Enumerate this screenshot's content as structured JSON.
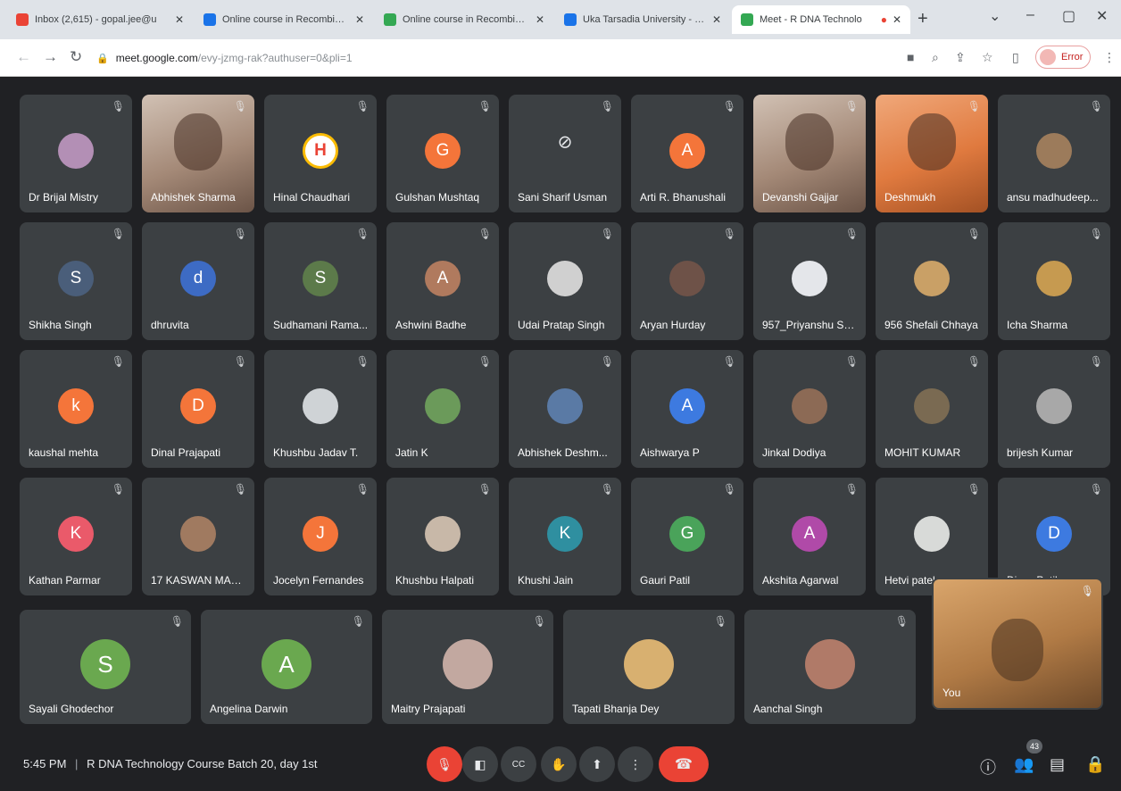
{
  "browser": {
    "tabs": [
      {
        "title": "Inbox (2,615) - gopal.jee@u",
        "color": "#ea4335",
        "active": false
      },
      {
        "title": "Online course in Recombinan",
        "color": "#1a73e8",
        "active": false
      },
      {
        "title": "Online course in Recombinan",
        "color": "#34a853",
        "active": false
      },
      {
        "title": "Uka Tarsadia University - Co",
        "color": "#1a73e8",
        "active": false
      },
      {
        "title": "Meet - R DNA Technolo",
        "color": "#34a853",
        "active": true
      }
    ],
    "url_host": "meet.google.com",
    "url_path": "/evy-jzmg-rak?authuser=0&pli=1",
    "profile_label": "Error"
  },
  "participants": [
    {
      "name": "Dr Brijal Mistry",
      "initial": "",
      "color": "#b38fb5",
      "kind": "photoavatar"
    },
    {
      "name": "Abhishek Sharma",
      "initial": "",
      "color": "",
      "kind": "video"
    },
    {
      "name": "Hinal Chaudhari",
      "initial": "H",
      "color": "#ffffff",
      "kind": "logo"
    },
    {
      "name": "Gulshan Mushtaq",
      "initial": "G",
      "color": "#f4753a",
      "kind": "letter"
    },
    {
      "name": "Sani Sharif Usman",
      "initial": "",
      "color": "",
      "kind": "camoff"
    },
    {
      "name": "Arti R. Bhanushali",
      "initial": "A",
      "color": "#f4753a",
      "kind": "letter"
    },
    {
      "name": "Devanshi Gajjar",
      "initial": "",
      "color": "",
      "kind": "video"
    },
    {
      "name": "Deshmukh",
      "initial": "",
      "color": "",
      "kind": "video"
    },
    {
      "name": "ansu madhudeep...",
      "initial": "",
      "color": "#9c7b5b",
      "kind": "photoavatar"
    },
    {
      "name": "Shikha Singh",
      "initial": "S",
      "color": "#4a5e7a",
      "kind": "letter"
    },
    {
      "name": "dhruvita",
      "initial": "d",
      "color": "#3d6bc4",
      "kind": "letter"
    },
    {
      "name": "Sudhamani Rama...",
      "initial": "S",
      "color": "#5c7a4a",
      "kind": "letter"
    },
    {
      "name": "Ashwini Badhe",
      "initial": "A",
      "color": "#b07a5e",
      "kind": "letter"
    },
    {
      "name": "Udai Pratap Singh",
      "initial": "",
      "color": "#d0d0d0",
      "kind": "photoavatar"
    },
    {
      "name": "Aryan Hurday",
      "initial": "",
      "color": "#6e5248",
      "kind": "photoavatar"
    },
    {
      "name": "957_Priyanshu Sh...",
      "initial": "",
      "color": "#e4e6ea",
      "kind": "photoavatar"
    },
    {
      "name": "956 Shefali Chhaya",
      "initial": "",
      "color": "#c9a066",
      "kind": "photoavatar"
    },
    {
      "name": "Icha Sharma",
      "initial": "",
      "color": "#c69a50",
      "kind": "photoavatar"
    },
    {
      "name": "kaushal mehta",
      "initial": "k",
      "color": "#f4753a",
      "kind": "letter"
    },
    {
      "name": "Dinal Prajapati",
      "initial": "D",
      "color": "#f4753a",
      "kind": "letter"
    },
    {
      "name": "Khushbu Jadav T.",
      "initial": "",
      "color": "#cfd3d6",
      "kind": "photoavatar"
    },
    {
      "name": "Jatin K",
      "initial": "",
      "color": "#6b9a5a",
      "kind": "photoavatar"
    },
    {
      "name": "Abhishek Deshm...",
      "initial": "",
      "color": "#5a7aa5",
      "kind": "photoavatar"
    },
    {
      "name": "Aishwarya P",
      "initial": "A",
      "color": "#3d7ae0",
      "kind": "letter"
    },
    {
      "name": "Jinkal Dodiya",
      "initial": "",
      "color": "#8c6a55",
      "kind": "photoavatar"
    },
    {
      "name": "MOHIT KUMAR",
      "initial": "",
      "color": "#7a6a52",
      "kind": "photoavatar"
    },
    {
      "name": "brijesh Kumar",
      "initial": "",
      "color": "#a8a8a8",
      "kind": "photoavatar"
    },
    {
      "name": "Kathan Parmar",
      "initial": "K",
      "color": "#ea5a6a",
      "kind": "letter"
    },
    {
      "name": "17 KASWAN MAM...",
      "initial": "",
      "color": "#a07a60",
      "kind": "photoavatar"
    },
    {
      "name": "Jocelyn Fernandes",
      "initial": "J",
      "color": "#f4753a",
      "kind": "letter"
    },
    {
      "name": "Khushbu Halpati",
      "initial": "",
      "color": "#c8b8a8",
      "kind": "photoavatar"
    },
    {
      "name": "Khushi Jain",
      "initial": "K",
      "color": "#2f8fa0",
      "kind": "letter"
    },
    {
      "name": "Gauri Patil",
      "initial": "G",
      "color": "#4aa35a",
      "kind": "letter"
    },
    {
      "name": "Akshita Agarwal",
      "initial": "A",
      "color": "#b04aa8",
      "kind": "letter"
    },
    {
      "name": "Hetvi patel",
      "initial": "",
      "color": "#d8dad8",
      "kind": "photoavatar"
    },
    {
      "name": "Divya Patil",
      "initial": "D",
      "color": "#3d7ae0",
      "kind": "letter"
    },
    {
      "name": "Sayali Ghodechor",
      "initial": "S",
      "color": "#6aa84f",
      "kind": "letter"
    },
    {
      "name": "Angelina Darwin",
      "initial": "A",
      "color": "#6aa84f",
      "kind": "letter"
    },
    {
      "name": "Maitry Prajapati",
      "initial": "",
      "color": "#c2a8a0",
      "kind": "photoavatar"
    },
    {
      "name": "Tapati Bhanja Dey",
      "initial": "",
      "color": "#d8b070",
      "kind": "photoavatar"
    },
    {
      "name": "Aanchal Singh",
      "initial": "",
      "color": "#b07a68",
      "kind": "photoavatar"
    }
  ],
  "self_view": {
    "label": "You"
  },
  "meeting": {
    "time": "5:45 PM",
    "separator": "|",
    "title": "R DNA Technology Course Batch 20, day 1st"
  },
  "participant_count": "43",
  "colors": {
    "stage": "#202124",
    "tile": "#3c4043",
    "danger": "#ea4335"
  }
}
